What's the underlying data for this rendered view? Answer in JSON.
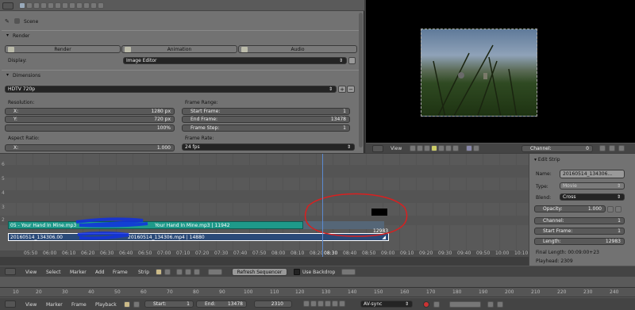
{
  "props": {
    "top_buttons": [
      "camera-icon",
      "render-icon",
      "layers-icon",
      "scene-icon",
      "world-icon",
      "object-icon",
      "constraint-icon",
      "modifier-icon",
      "data-icon",
      "material-icon",
      "texture-icon",
      "particles-icon",
      "physics-icon"
    ],
    "scene_label": "Scene",
    "render_panel": {
      "title": "Render",
      "render_btn": "Render",
      "animation_btn": "Animation",
      "audio_btn": "Audio",
      "display_label": "Display:",
      "display_value": "Image Editor"
    },
    "dimensions_panel": {
      "title": "Dimensions",
      "preset": "HDTV 720p",
      "resolution_label": "Resolution:",
      "res_x_label": "X:",
      "res_x_value": "1280 px",
      "res_y_label": "Y:",
      "res_y_value": "720 px",
      "res_pct": "100%",
      "aspect_label": "Aspect Ratio:",
      "aspect_x_label": "X:",
      "aspect_x_value": "1.000",
      "frame_range_label": "Frame Range:",
      "start_label": "Start Frame:",
      "start_value": "1",
      "end_label": "End Frame:",
      "end_value": "13478",
      "step_label": "Frame Step:",
      "step_value": "1",
      "rate_label": "Frame Rate:",
      "rate_value": "24 fps"
    }
  },
  "preview_header": {
    "view": "View",
    "channel_label": "Channel:",
    "channel_value": "0"
  },
  "edit_strip": {
    "title": "Edit Strip",
    "name_label": "Name:",
    "name_value": "20160514_134306...",
    "type_label": "Type:",
    "type_value": "Movie",
    "blend_label": "Blend:",
    "blend_value": "Cross",
    "opacity_label": "Opacity:",
    "opacity_value": "1.000",
    "channel_label": "Channel:",
    "channel_value": "1",
    "start_label": "Start Frame:",
    "start_value": "1",
    "length_label": "Length:",
    "length_value": "12983",
    "final_length": "Final Length: 00:09:00+23",
    "playhead": "Playhead: 2309"
  },
  "sequencer": {
    "channel_nums": [
      "6",
      "5",
      "4",
      "3",
      "2"
    ],
    "audio_strip_left": "05 - Your Hand In Mine.mp3",
    "audio_strip_right": "Your Hand In Mine.mp3 | 11942",
    "video_strip_left": "20160514_134306.00",
    "video_strip_right": "20160514_134306.mp4 | 14880",
    "tooltip_value": "12983",
    "time_ticks": [
      "05:50",
      "06:00",
      "06:10",
      "06:20",
      "06:30",
      "06:40",
      "06:50",
      "07:00",
      "07:10",
      "07:20",
      "07:30",
      "07:40",
      "07:50",
      "08:00",
      "08:10",
      "08:20",
      "08:30",
      "08:40",
      "08:50",
      "09:00",
      "09:10",
      "09:20",
      "09:30",
      "09:40",
      "09:50",
      "10:00",
      "10:10"
    ],
    "menus": [
      "View",
      "Select",
      "Marker",
      "Add",
      "Frame",
      "Strip"
    ],
    "refresh_btn": "Refresh Sequencer",
    "backdrop_label": "Use Backdrop"
  },
  "timeline": {
    "ticks": [
      "10",
      "20",
      "30",
      "40",
      "50",
      "60",
      "70",
      "80",
      "90",
      "100",
      "110",
      "120",
      "130",
      "140",
      "150",
      "160",
      "170",
      "180",
      "190",
      "200",
      "210",
      "220",
      "230",
      "240"
    ],
    "menus": [
      "View",
      "Marker",
      "Frame",
      "Playback"
    ],
    "start_label": "Start:",
    "start_value": "1",
    "end_label": "End:",
    "end_value": "13478",
    "current_value": "2310",
    "sync_value": "AV-sync"
  },
  "colors": {
    "audio_strip": "#1e9a8a",
    "video_strip": "#2a4a78",
    "annotation": "#d82020",
    "scribble": "#1030e0"
  }
}
